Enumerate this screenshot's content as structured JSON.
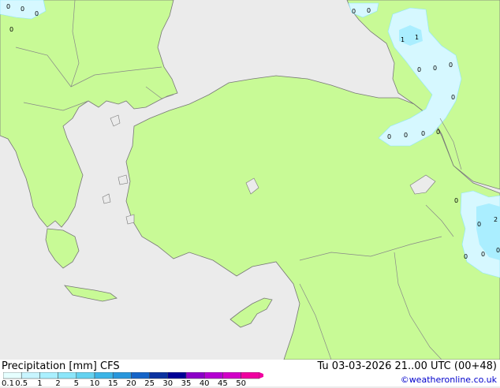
{
  "title": {
    "product": "Precipitation [mm]",
    "model": "CFS",
    "datetime": "Tu 03-03-2026 21..00 UTC (00+48)"
  },
  "credit": "©weatheronline.co.uk",
  "legend": {
    "labels": [
      "0.1",
      "0.5",
      "1",
      "2",
      "5",
      "10",
      "15",
      "20",
      "25",
      "30",
      "35",
      "40",
      "45",
      "50"
    ],
    "colors": [
      "#e6ffff",
      "#c8f5ff",
      "#aaf0ff",
      "#8ce6fa",
      "#64d2f0",
      "#3cb4e6",
      "#2896dc",
      "#1464c8",
      "#0a32a0",
      "#000096",
      "#8c00c8",
      "#b400d2",
      "#d200c8",
      "#f000a0"
    ]
  },
  "map": {
    "colors": {
      "sea": "#ebebeb",
      "land_dry": "#c8fa96",
      "precip_light": "#d6f8ff",
      "precip_mod": "#aaeeff",
      "border": "#888888",
      "coast": "#777777"
    },
    "value_markers": [
      "0",
      "0",
      "0",
      "0",
      "1",
      "1",
      "0",
      "0",
      "0",
      "0",
      "0",
      "0",
      "0",
      "0",
      "0",
      "0",
      "2",
      "0",
      "0",
      "0",
      "0",
      "0"
    ]
  }
}
